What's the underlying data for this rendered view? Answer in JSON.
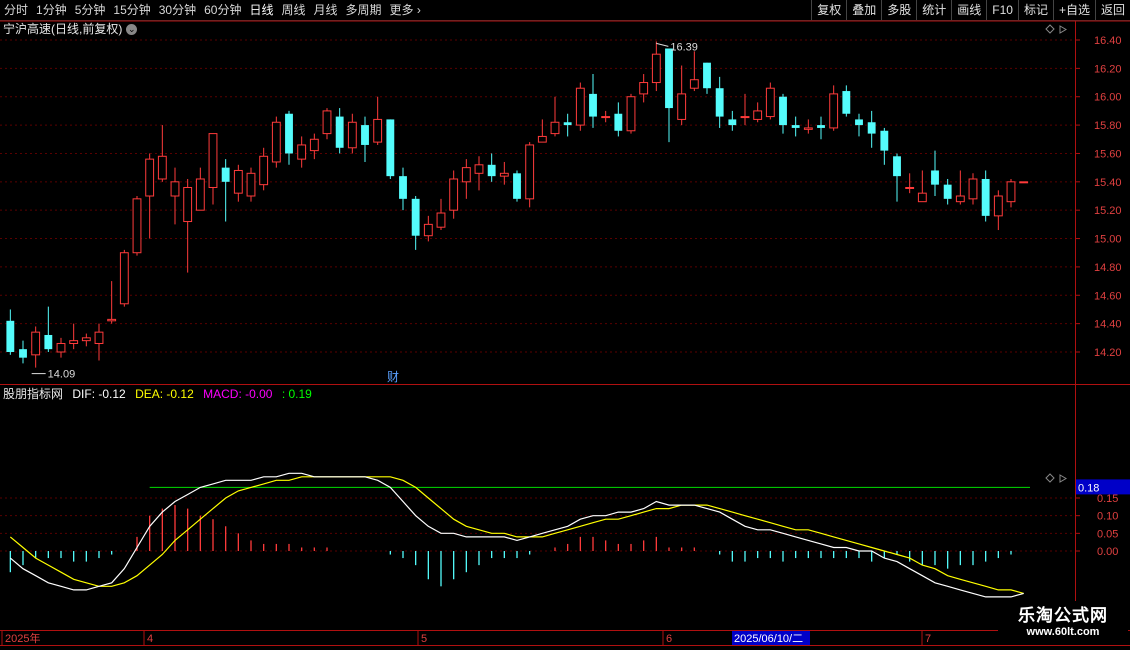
{
  "toolbar": {
    "periods": [
      "分时",
      "1分钟",
      "5分钟",
      "15分钟",
      "30分钟",
      "60分钟",
      "日线",
      "周线",
      "月线",
      "多周期",
      "更多"
    ],
    "active_period": "日线",
    "right_buttons": [
      "复权",
      "叠加",
      "多股",
      "统计",
      "画线",
      "F10",
      "+自选",
      "返回"
    ],
    "right_label_mark": "标记"
  },
  "stock": {
    "title": "宁沪高速(日线,前复权)",
    "high_label": "16.39",
    "low_label": "14.09",
    "finance_marker": "财"
  },
  "indicator": {
    "name": "股朋指标网",
    "dif_text": "DIF: -0.12",
    "dea_text": "DEA: -0.12",
    "macd_text": "MACD: -0.00",
    "extra_text": ": 0.19",
    "level_label": "0.18",
    "colors": {
      "dif": "#ffffff",
      "dea": "#ffff00",
      "macd": "#ff00ff",
      "extra": "#00ff00"
    }
  },
  "price_axis": [
    "16.40",
    "16.20",
    "16.00",
    "15.80",
    "15.60",
    "15.40",
    "15.20",
    "15.00",
    "14.80",
    "14.60",
    "14.40",
    "14.20"
  ],
  "macd_axis": [
    "0.15",
    "0.10",
    "0.05",
    "0.00"
  ],
  "time_axis": {
    "start": "2025年",
    "m4": "4",
    "m5": "5",
    "m6": "6",
    "m7": "7",
    "cursor_date": "2025/06/10/二"
  },
  "watermark": {
    "line1": "乐淘公式网",
    "line2": "www.60lt.com"
  },
  "chart_data": {
    "type": "candlestick",
    "title": "宁沪高速(日线,前复权)",
    "price_range": [
      14.08,
      16.5
    ],
    "up_color": "#ff3b3b",
    "down_color": "#54fcfc",
    "candles": [
      [
        14.42,
        14.2,
        14.5,
        14.18
      ],
      [
        14.22,
        14.16,
        14.28,
        14.12
      ],
      [
        14.18,
        14.34,
        14.38,
        14.09
      ],
      [
        14.32,
        14.22,
        14.52,
        14.2
      ],
      [
        14.2,
        14.26,
        14.3,
        14.16
      ],
      [
        14.26,
        14.28,
        14.4,
        14.22
      ],
      [
        14.28,
        14.3,
        14.33,
        14.24
      ],
      [
        14.26,
        14.34,
        14.4,
        14.14
      ],
      [
        14.42,
        14.43,
        14.7,
        14.4
      ],
      [
        14.54,
        14.9,
        14.92,
        14.52
      ],
      [
        14.9,
        15.28,
        15.3,
        14.88
      ],
      [
        15.3,
        15.56,
        15.6,
        15.0
      ],
      [
        15.42,
        15.58,
        15.8,
        15.4
      ],
      [
        15.3,
        15.4,
        15.5,
        15.1
      ],
      [
        15.12,
        15.36,
        15.42,
        14.76
      ],
      [
        15.2,
        15.42,
        15.5,
        15.2
      ],
      [
        15.36,
        15.74,
        15.74,
        15.24
      ],
      [
        15.5,
        15.4,
        15.56,
        15.12
      ],
      [
        15.32,
        15.48,
        15.52,
        15.26
      ],
      [
        15.3,
        15.46,
        15.5,
        15.26
      ],
      [
        15.38,
        15.58,
        15.64,
        15.34
      ],
      [
        15.54,
        15.82,
        15.86,
        15.5
      ],
      [
        15.88,
        15.6,
        15.9,
        15.52
      ],
      [
        15.56,
        15.66,
        15.72,
        15.5
      ],
      [
        15.62,
        15.7,
        15.74,
        15.56
      ],
      [
        15.74,
        15.9,
        15.92,
        15.7
      ],
      [
        15.86,
        15.64,
        15.92,
        15.6
      ],
      [
        15.64,
        15.82,
        15.88,
        15.6
      ],
      [
        15.8,
        15.66,
        15.86,
        15.54
      ],
      [
        15.68,
        15.84,
        16.0,
        15.66
      ],
      [
        15.84,
        15.44,
        15.84,
        15.42
      ],
      [
        15.44,
        15.28,
        15.5,
        15.2
      ],
      [
        15.28,
        15.02,
        15.3,
        14.92
      ],
      [
        15.02,
        15.1,
        15.16,
        14.98
      ],
      [
        15.08,
        15.18,
        15.28,
        15.06
      ],
      [
        15.2,
        15.42,
        15.48,
        15.14
      ],
      [
        15.4,
        15.5,
        15.56,
        15.28
      ],
      [
        15.46,
        15.52,
        15.58,
        15.34
      ],
      [
        15.52,
        15.44,
        15.6,
        15.4
      ],
      [
        15.44,
        15.46,
        15.54,
        15.38
      ],
      [
        15.46,
        15.28,
        15.48,
        15.26
      ],
      [
        15.28,
        15.66,
        15.68,
        15.22
      ],
      [
        15.68,
        15.72,
        15.84,
        15.68
      ],
      [
        15.74,
        15.82,
        16.0,
        15.72
      ],
      [
        15.82,
        15.8,
        15.88,
        15.72
      ],
      [
        15.8,
        16.06,
        16.1,
        15.76
      ],
      [
        16.02,
        15.86,
        16.16,
        15.78
      ],
      [
        15.86,
        15.86,
        15.9,
        15.82
      ],
      [
        15.88,
        15.76,
        15.96,
        15.72
      ],
      [
        15.76,
        16.0,
        16.02,
        15.74
      ],
      [
        16.02,
        16.1,
        16.16,
        15.96
      ],
      [
        16.1,
        16.3,
        16.39,
        16.04
      ],
      [
        16.34,
        15.92,
        16.34,
        15.68
      ],
      [
        15.84,
        16.02,
        16.22,
        15.8
      ],
      [
        16.06,
        16.12,
        16.32,
        16.04
      ],
      [
        16.24,
        16.06,
        16.24,
        16.02
      ],
      [
        16.06,
        15.86,
        16.14,
        15.78
      ],
      [
        15.84,
        15.8,
        15.9,
        15.76
      ],
      [
        15.86,
        15.86,
        16.02,
        15.8
      ],
      [
        15.84,
        15.9,
        15.96,
        15.82
      ],
      [
        15.86,
        16.06,
        16.1,
        15.84
      ],
      [
        16.0,
        15.8,
        16.02,
        15.74
      ],
      [
        15.8,
        15.78,
        15.86,
        15.72
      ],
      [
        15.77,
        15.78,
        15.84,
        15.74
      ],
      [
        15.8,
        15.78,
        15.86,
        15.7
      ],
      [
        15.78,
        16.02,
        16.08,
        15.76
      ],
      [
        16.04,
        15.88,
        16.08,
        15.86
      ],
      [
        15.84,
        15.8,
        15.88,
        15.72
      ],
      [
        15.82,
        15.74,
        15.9,
        15.64
      ],
      [
        15.76,
        15.62,
        15.78,
        15.52
      ],
      [
        15.58,
        15.44,
        15.6,
        15.26
      ],
      [
        15.36,
        15.36,
        15.46,
        15.32
      ],
      [
        15.26,
        15.32,
        15.48,
        15.26
      ],
      [
        15.48,
        15.38,
        15.62,
        15.3
      ],
      [
        15.38,
        15.28,
        15.42,
        15.24
      ],
      [
        15.26,
        15.3,
        15.48,
        15.24
      ],
      [
        15.28,
        15.42,
        15.46,
        15.24
      ],
      [
        15.42,
        15.16,
        15.48,
        15.12
      ],
      [
        15.16,
        15.3,
        15.34,
        15.06
      ],
      [
        15.26,
        15.4,
        15.42,
        15.22
      ],
      [
        15.4,
        15.4,
        15.4,
        15.4
      ]
    ],
    "macd_range": [
      -0.13,
      0.23
    ],
    "macd_hist": [
      -0.06,
      -0.04,
      -0.02,
      -0.02,
      -0.02,
      -0.03,
      -0.03,
      -0.02,
      -0.01,
      0.0,
      0.04,
      0.1,
      0.12,
      0.13,
      0.12,
      0.1,
      0.09,
      0.07,
      0.05,
      0.03,
      0.02,
      0.02,
      0.02,
      0.01,
      0.01,
      0.01,
      0.0,
      0.0,
      0.0,
      0.0,
      -0.01,
      -0.02,
      -0.04,
      -0.08,
      -0.1,
      -0.08,
      -0.06,
      -0.04,
      -0.02,
      -0.02,
      -0.02,
      -0.01,
      0.0,
      0.01,
      0.02,
      0.04,
      0.04,
      0.03,
      0.02,
      0.02,
      0.03,
      0.04,
      0.01,
      0.01,
      0.01,
      0.0,
      -0.01,
      -0.03,
      -0.03,
      -0.02,
      -0.02,
      -0.03,
      -0.02,
      -0.02,
      -0.02,
      -0.02,
      -0.02,
      -0.02,
      -0.03,
      -0.02,
      -0.01,
      -0.03,
      -0.04,
      -0.04,
      -0.05,
      -0.04,
      -0.04,
      -0.03,
      -0.02,
      -0.01,
      -0.0
    ],
    "dif": [
      -0.02,
      -0.05,
      -0.07,
      -0.09,
      -0.1,
      -0.11,
      -0.11,
      -0.1,
      -0.09,
      -0.05,
      0.01,
      0.07,
      0.11,
      0.14,
      0.16,
      0.18,
      0.19,
      0.2,
      0.2,
      0.2,
      0.21,
      0.21,
      0.22,
      0.22,
      0.21,
      0.21,
      0.21,
      0.21,
      0.21,
      0.2,
      0.18,
      0.14,
      0.1,
      0.07,
      0.05,
      0.05,
      0.04,
      0.04,
      0.04,
      0.04,
      0.03,
      0.04,
      0.05,
      0.06,
      0.07,
      0.09,
      0.1,
      0.1,
      0.11,
      0.11,
      0.12,
      0.14,
      0.13,
      0.13,
      0.13,
      0.12,
      0.11,
      0.09,
      0.07,
      0.06,
      0.06,
      0.05,
      0.04,
      0.03,
      0.02,
      0.01,
      0.01,
      0.0,
      -0.0,
      -0.02,
      -0.03,
      -0.05,
      -0.07,
      -0.09,
      -0.1,
      -0.11,
      -0.12,
      -0.13,
      -0.13,
      -0.13,
      -0.12
    ],
    "dea": [
      0.04,
      0.01,
      -0.02,
      -0.04,
      -0.06,
      -0.08,
      -0.09,
      -0.1,
      -0.1,
      -0.09,
      -0.07,
      -0.04,
      -0.01,
      0.03,
      0.06,
      0.09,
      0.12,
      0.15,
      0.17,
      0.18,
      0.19,
      0.2,
      0.2,
      0.21,
      0.21,
      0.21,
      0.21,
      0.21,
      0.21,
      0.21,
      0.21,
      0.2,
      0.18,
      0.15,
      0.12,
      0.09,
      0.07,
      0.06,
      0.05,
      0.05,
      0.04,
      0.04,
      0.04,
      0.05,
      0.06,
      0.07,
      0.08,
      0.09,
      0.09,
      0.1,
      0.11,
      0.12,
      0.12,
      0.13,
      0.13,
      0.13,
      0.12,
      0.11,
      0.1,
      0.09,
      0.08,
      0.07,
      0.06,
      0.06,
      0.05,
      0.04,
      0.03,
      0.02,
      0.01,
      0.0,
      -0.01,
      -0.02,
      -0.04,
      -0.05,
      -0.07,
      -0.08,
      -0.09,
      -0.1,
      -0.11,
      -0.11,
      -0.12
    ],
    "level_line": 0.18
  }
}
